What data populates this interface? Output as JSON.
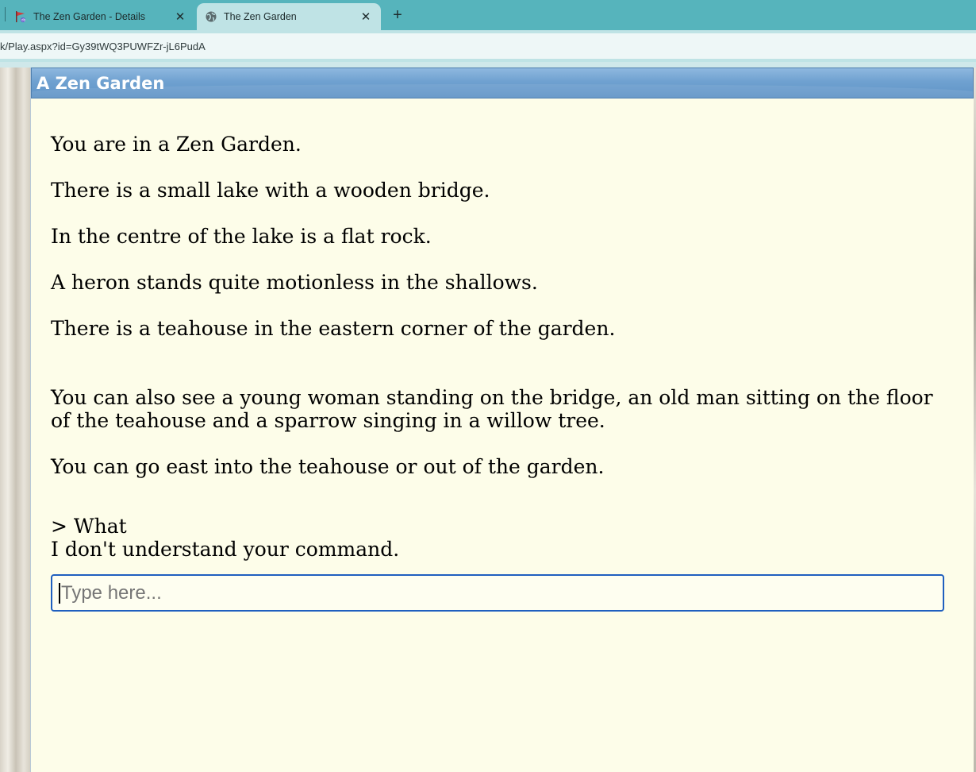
{
  "browser": {
    "tabs": [
      {
        "title": "The Zen Garden - Details",
        "icon": "ifdb-flag-icon",
        "active": false
      },
      {
        "title": "The Zen Garden",
        "icon": "globe-icon",
        "active": true
      }
    ],
    "close_glyph": "✕",
    "new_tab_glyph": "+",
    "url": "k/Play.aspx?id=Gy39tWQ3PUWFZr-jL6PudA"
  },
  "game": {
    "title": "A Zen Garden",
    "room_description": [
      "You are in a Zen Garden.",
      "There is a small lake with a wooden bridge.",
      "In the centre of the lake is a flat rock.",
      "A heron stands quite motionless in the shallows.",
      "There is a teahouse in the eastern corner of the garden."
    ],
    "objects_text": "You can also see a young woman standing on the bridge, an old man sitting on the floor of the teahouse and a sparrow singing in a willow tree.",
    "exits_text": "You can go east into the teahouse or out of the garden.",
    "last_command": "> What",
    "response": "I don't understand your command.",
    "input": {
      "value": "",
      "placeholder": "Type here..."
    }
  },
  "colors": {
    "tab_bar": "#56b4bc",
    "active_tab": "#bfe3e5",
    "panel_background": "#fdfde9",
    "header_blue": "#6fa1d0",
    "input_border": "#1f5fbf"
  }
}
